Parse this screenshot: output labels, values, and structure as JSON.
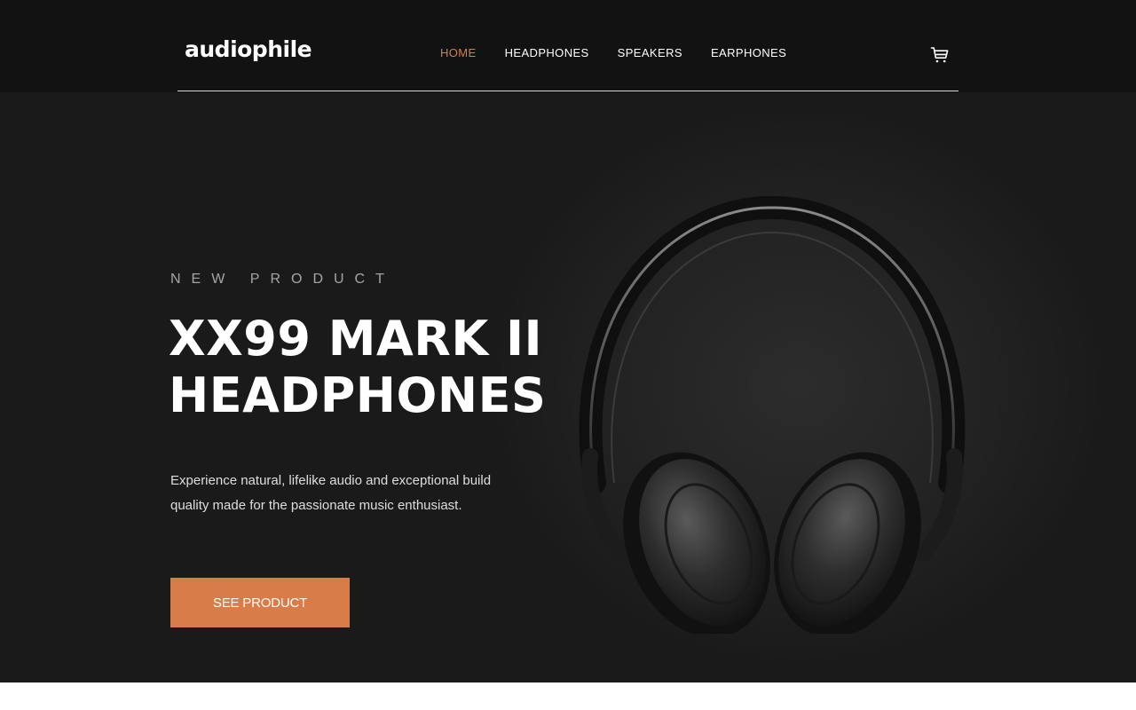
{
  "header": {
    "logo": "audiophile",
    "nav": [
      {
        "label": "HOME",
        "active": true
      },
      {
        "label": "HEADPHONES",
        "active": false
      },
      {
        "label": "SPEAKERS",
        "active": false
      },
      {
        "label": "EARPHONES",
        "active": false
      }
    ],
    "cart_icon": "cart-icon"
  },
  "hero": {
    "overline": "NEW PRODUCT",
    "title_line1": "XX99 MARK II",
    "title_line2": "HEADPHONES",
    "description": "Experience natural, lifelike audio and exceptional build quality made for the passionate music enthusiast.",
    "cta_label": "SEE PRODUCT",
    "image": "headphones-product-image"
  },
  "colors": {
    "accent": "#d87d4a",
    "header_bg": "#121212",
    "hero_bg": "#1a1a1a",
    "text_light": "#ffffff"
  }
}
